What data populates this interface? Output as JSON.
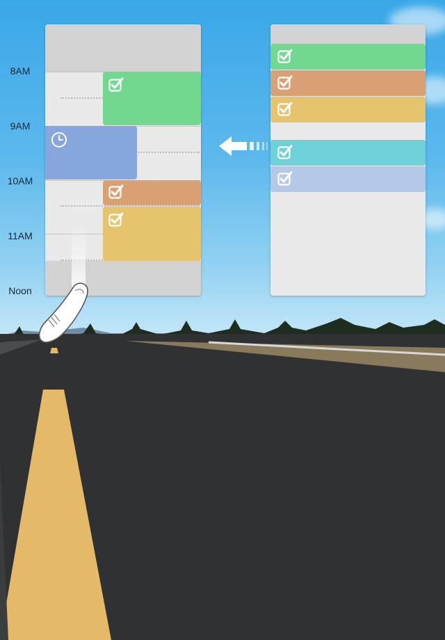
{
  "colors": {
    "green": "#72d88f",
    "orange": "#d9a073",
    "yellow": "#e6c46e",
    "blue": "#87a6dd",
    "teal": "#6fd1d8",
    "lavender": "#b6c8e8",
    "panel": "#e9e9e9",
    "panel_header": "#d2d2d2"
  },
  "time_labels": [
    "8AM",
    "9AM",
    "10AM",
    "11AM",
    "Noon"
  ],
  "calendar": {
    "events": [
      {
        "kind": "task",
        "color": "green",
        "icon": "check-icon"
      },
      {
        "kind": "appointment",
        "color": "blue",
        "icon": "clock-icon"
      },
      {
        "kind": "task",
        "color": "orange",
        "icon": "check-icon"
      },
      {
        "kind": "task",
        "color": "yellow",
        "icon": "check-icon"
      }
    ]
  },
  "task_list": {
    "items": [
      {
        "color": "green",
        "icon": "check-icon"
      },
      {
        "color": "orange",
        "icon": "check-icon"
      },
      {
        "color": "yellow",
        "icon": "check-icon"
      },
      {
        "color": "teal",
        "icon": "check-icon"
      },
      {
        "color": "lavender",
        "icon": "check-icon"
      }
    ]
  },
  "gesture": {
    "icon": "drag-arrow-icon",
    "hand": "finger-icon"
  }
}
